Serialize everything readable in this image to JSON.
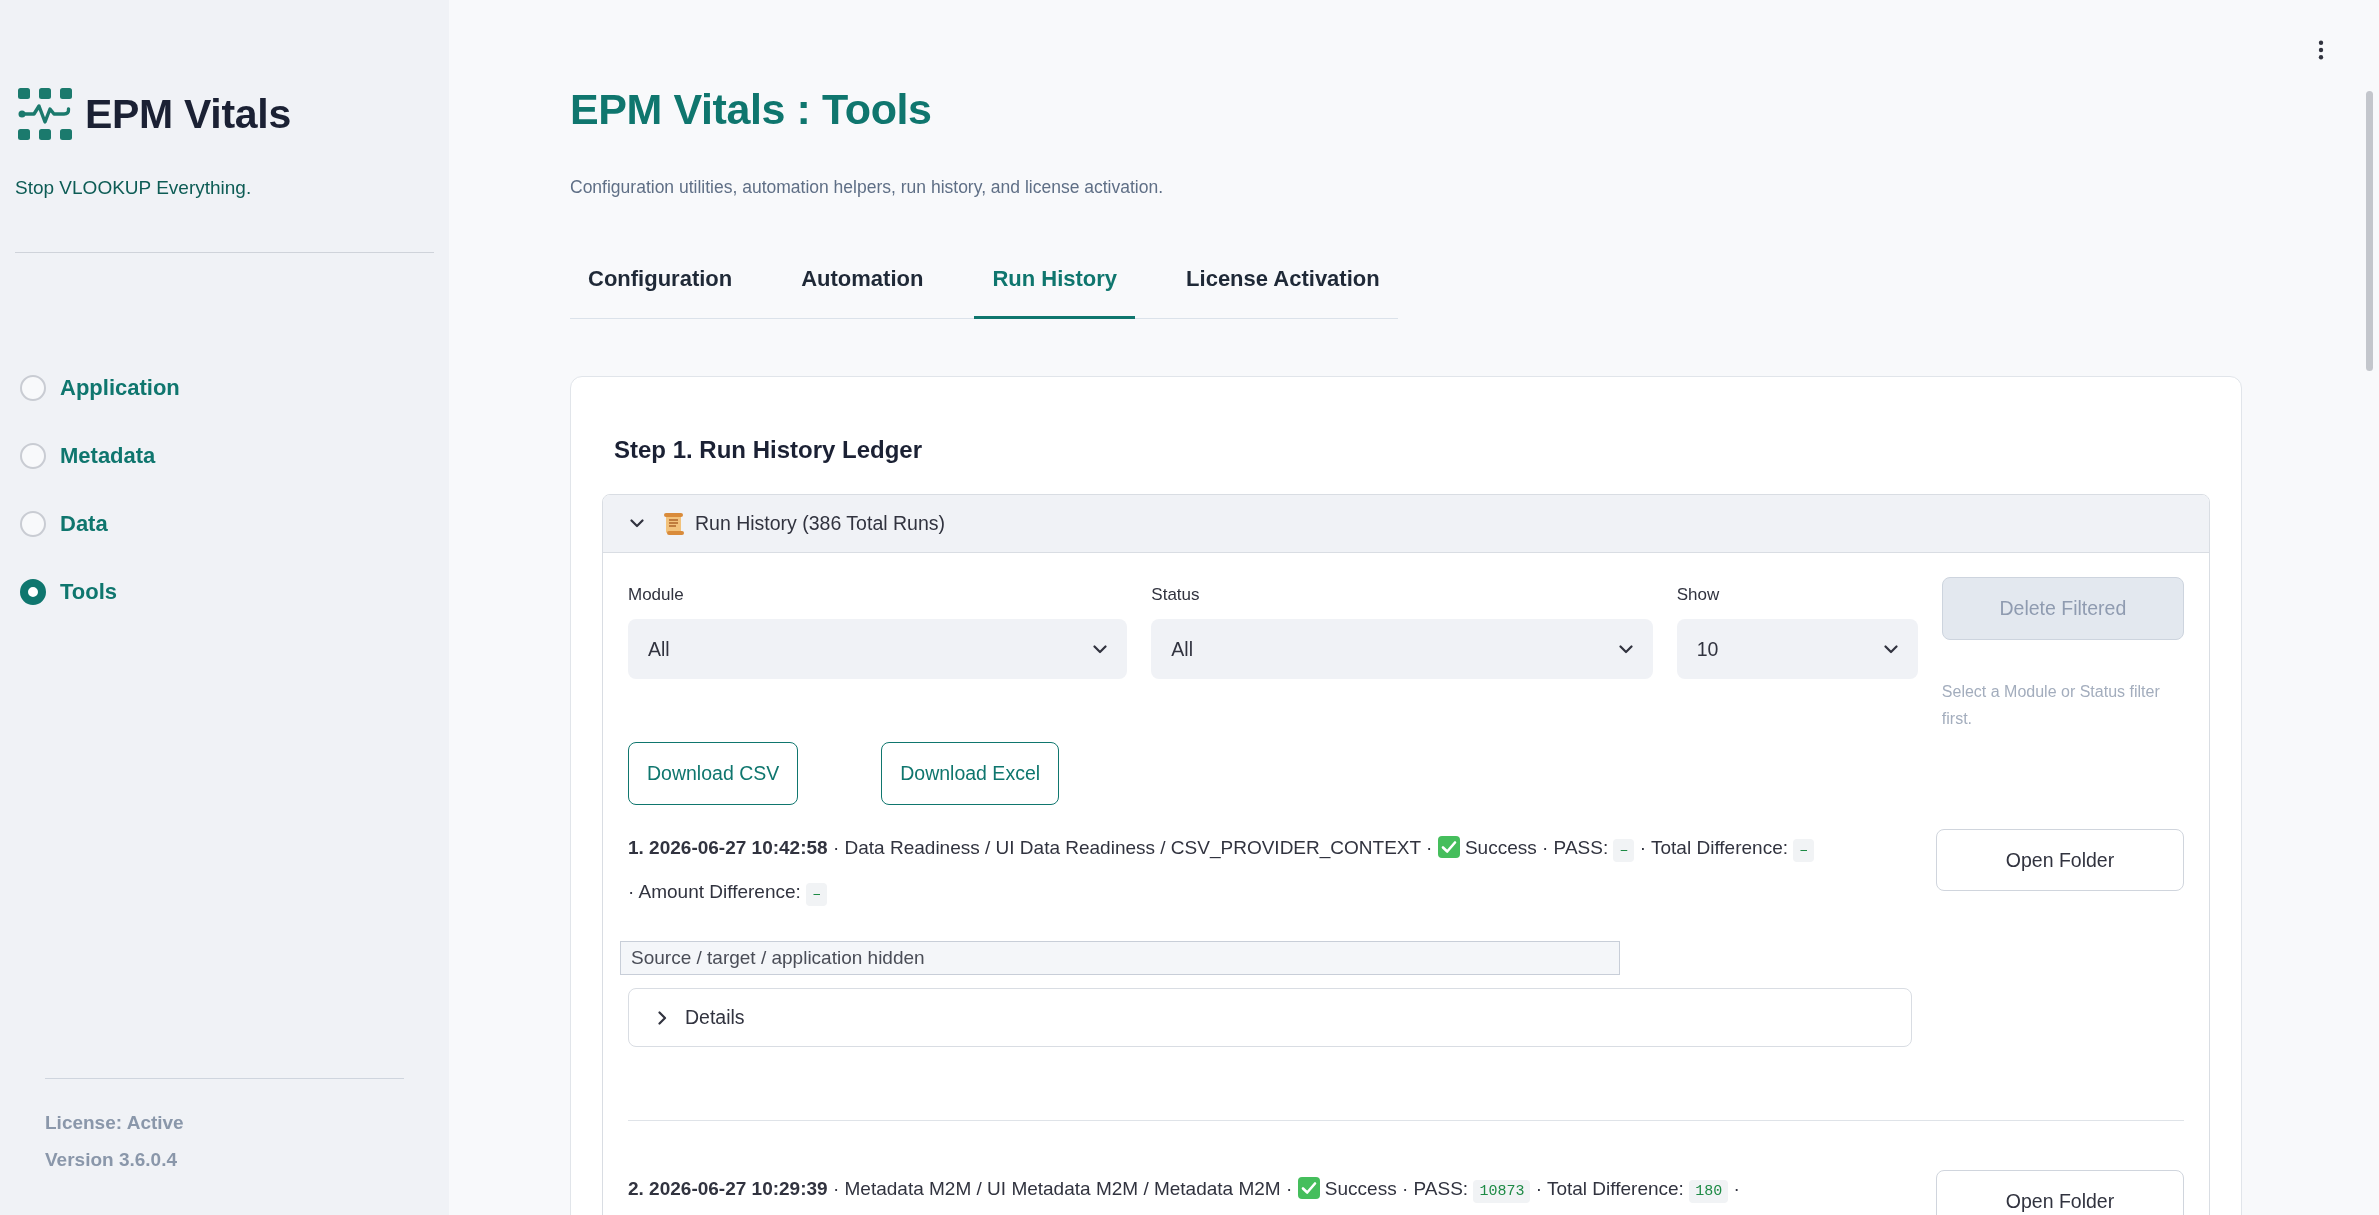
{
  "sidebar": {
    "brand": "EPM Vitals",
    "tagline": "Stop VLOOKUP Everything.",
    "nav": [
      {
        "label": "Application",
        "selected": false
      },
      {
        "label": "Metadata",
        "selected": false
      },
      {
        "label": "Data",
        "selected": false
      },
      {
        "label": "Tools",
        "selected": true
      }
    ],
    "license": "License: Active",
    "version": "Version 3.6.0.4"
  },
  "header": {
    "title": "EPM Vitals : Tools",
    "subtitle": "Configuration utilities, automation helpers, run history, and license activation."
  },
  "tabs": [
    {
      "label": "Configuration",
      "selected": false
    },
    {
      "label": "Automation",
      "selected": false
    },
    {
      "label": "Run History",
      "selected": true
    },
    {
      "label": "License Activation",
      "selected": false
    }
  ],
  "ledger": {
    "heading": "Step 1. Run History Ledger",
    "expander": {
      "title": "Run History (386 Total Runs)",
      "expanded": true
    },
    "filters": [
      {
        "label": "Module",
        "value": "All"
      },
      {
        "label": "Status",
        "value": "All"
      },
      {
        "label": "Show",
        "value": "10"
      }
    ],
    "delete_button": {
      "label": "Delete Filtered",
      "disabled": true
    },
    "delete_hint": "Select a Module or Status filter first.",
    "downloads": [
      "Download CSV",
      "Download Excel"
    ],
    "runs": [
      {
        "parts": [
          {
            "kind": "bold",
            "text": "1. 2026-06-27 10:42:58"
          },
          {
            "kind": "text",
            "text": "· Data Readiness / UI Data Readiness / CSV_PROVIDER_CONTEXT ·"
          },
          {
            "kind": "status",
            "success": true
          },
          {
            "kind": "text",
            "text": "Success · PASS:"
          },
          {
            "kind": "code",
            "text": "–"
          },
          {
            "kind": "text",
            "text": "· Total Difference:"
          },
          {
            "kind": "code",
            "text": "–"
          },
          {
            "kind": "text",
            "text": "· Amount Difference:"
          },
          {
            "kind": "code",
            "text": "–"
          }
        ],
        "notice": "Source / target / application hidden",
        "details": {
          "label": "Details",
          "expanded": false
        },
        "button": "Open Folder"
      },
      {
        "parts": [
          {
            "kind": "bold",
            "text": "2. 2026-06-27 10:29:39"
          },
          {
            "kind": "text",
            "text": "· Metadata M2M / UI Metadata M2M / Metadata M2M ·"
          },
          {
            "kind": "status",
            "success": true
          },
          {
            "kind": "text",
            "text": "Success · PASS:"
          },
          {
            "kind": "code",
            "text": "10873"
          },
          {
            "kind": "text",
            "text": "· Total Difference:"
          },
          {
            "kind": "code",
            "text": "180"
          },
          {
            "kind": "text",
            "text": "·"
          }
        ],
        "button": "Open Folder"
      }
    ]
  }
}
